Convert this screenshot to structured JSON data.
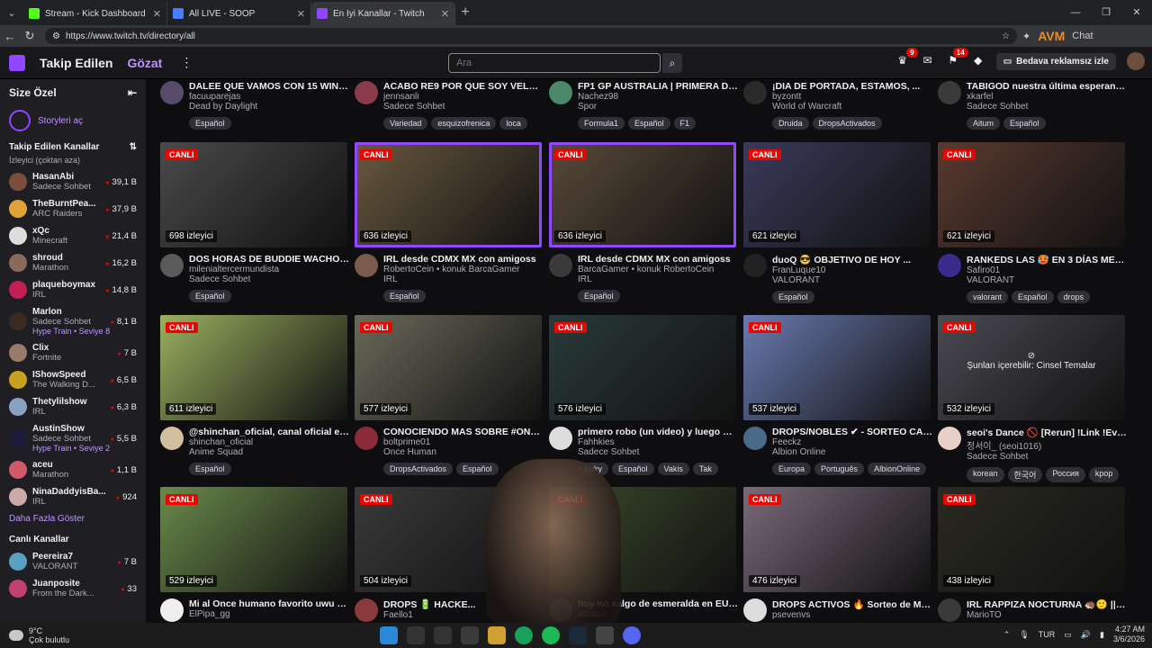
{
  "browser": {
    "tabs": [
      {
        "label": "Stream - Kick Dashboard",
        "color": "#53fc18"
      },
      {
        "label": "All LIVE - SOOP",
        "color": "#4a7cff"
      },
      {
        "label": "En İyi Kanallar - Twitch",
        "color": "#9146ff"
      }
    ],
    "url": "https://www.twitch.tv/directory/all",
    "ext_brand": "AVM",
    "ext_chat": "Chat"
  },
  "header": {
    "nav_following": "Takip Edilen",
    "nav_browse": "Gözat",
    "search_placeholder": "Ara",
    "badge_inbox": "9",
    "badge_notif": "14",
    "ad_free": "Bedava reklamsız izle"
  },
  "sidebar": {
    "title": "Size Özel",
    "stories": "Storyleri aç",
    "followed_title": "Takip Edilen Kanallar",
    "followed_sub": "İzleyici (çoktan aza)",
    "channels": [
      {
        "name": "HasanAbi",
        "game": "Sadece Sohbet",
        "viewers": "39,1 B",
        "color": "#7a4e3a"
      },
      {
        "name": "TheBurntPea...",
        "game": "ARC Raiders",
        "viewers": "37,9 B",
        "color": "#e2a23a"
      },
      {
        "name": "xQc",
        "game": "Minecraft",
        "viewers": "21,4 B",
        "color": "#ddd"
      },
      {
        "name": "shroud",
        "game": "Marathon",
        "viewers": "16,2 B",
        "color": "#8a6a5a"
      },
      {
        "name": "plaqueboymax",
        "game": "IRL",
        "viewers": "14,8 B",
        "color": "#c21f55"
      },
      {
        "name": "Marlon",
        "game": "Sadece Sohbet",
        "viewers": "8,1 B",
        "color": "#3a2a22",
        "hype": "Hype Train • Seviye 8"
      },
      {
        "name": "Clix",
        "game": "Fortnite",
        "viewers": "7 B",
        "color": "#9a7a6a"
      },
      {
        "name": "IShowSpeed",
        "game": "The Walking D...",
        "viewers": "6,5 B",
        "color": "#c9a020"
      },
      {
        "name": "Thetylilshow",
        "game": "IRL",
        "viewers": "6,3 B",
        "color": "#8aa0c0"
      },
      {
        "name": "AustinShow",
        "game": "Sadece Sohbet",
        "viewers": "5,5 B",
        "color": "#1a1a3a",
        "hype": "Hype Train • Seviye 2"
      },
      {
        "name": "aceu",
        "game": "Marathon",
        "viewers": "1,1 B",
        "color": "#d05a6a"
      },
      {
        "name": "NinaDaddyisBa...",
        "game": "IRL",
        "viewers": "924",
        "color": "#caa"
      }
    ],
    "show_more": "Daha Fazla Göster",
    "live_title": "Canlı Kanallar",
    "live_channels": [
      {
        "name": "Peereira7",
        "game": "VALORANT",
        "viewers": "7 B",
        "color": "#5aa0c0"
      },
      {
        "name": "Juanposite",
        "game": "From the Dark...",
        "viewers": "33",
        "color": "#c04070"
      }
    ]
  },
  "top_row": [
    {
      "title": "DALEE QUE VAMOS CON 15 WINS ...",
      "channel": "facuuparejas",
      "game": "Dead by Daylight",
      "tags": [
        "Español"
      ],
      "color": "#5a4a6a"
    },
    {
      "title": "ACABO RE9 POR QUE SOY VELOZZZ...",
      "channel": "jennsanli",
      "game": "Sadece Sohbet",
      "tags": [
        "Variedad",
        "esquizofrenica",
        "loca"
      ],
      "color": "#8a3a4a"
    },
    {
      "title": "FP1 GP AUSTRALIA | PRIMERA DEL A...",
      "channel": "Nachez98",
      "game": "Spor",
      "tags": [
        "Formula1",
        "Español",
        "F1"
      ],
      "color": "#4a8a6a"
    },
    {
      "title": "¡DIA DE PORTADA, ESTAMOS, ...",
      "channel": "byzontt",
      "game": "World of Warcraft",
      "tags": [
        "Druida",
        "DropsActivados"
      ],
      "color": "#2a2a2a"
    },
    {
      "title": "TABIGOD nuestra última esperanza e...",
      "channel": "xkarfel",
      "game": "Sadece Sohbet",
      "tags": [
        "Aitum",
        "Español"
      ],
      "color": "#3a3a3a"
    }
  ],
  "rows": [
    [
      {
        "title": "DOS HORAS DE BUDDIE WACHO BAS...",
        "channel": "milenialtercermundista",
        "game": "Sadece Sohbet",
        "tags": [
          "Español"
        ],
        "viewers": "698 izleyici",
        "thumb": "#4a4a4a",
        "avatar": "#5a5a5a"
      },
      {
        "title": "IRL desde CDMX MX con amigoss",
        "channel": "RobertoCein • konuk BarcaGamer",
        "game": "IRL",
        "tags": [
          "Español"
        ],
        "viewers": "636 izleyici",
        "thumb": "#6a5a40",
        "avatar": "#7a5a4a",
        "sel": true
      },
      {
        "title": "IRL desde CDMX MX con amigoss",
        "channel": "BarcaGamer • konuk RobertoCein",
        "game": "IRL",
        "tags": [
          "Español"
        ],
        "viewers": "636 izleyici",
        "thumb": "#5a4a3a",
        "avatar": "#3a3a3a",
        "sel": true
      },
      {
        "title": "duoQ 😎 OBJETIVO DE HOY ...",
        "channel": "FranLuque10",
        "game": "VALORANT",
        "tags": [
          "Español"
        ],
        "viewers": "621 izleyici",
        "thumb": "#3a3a5a",
        "avatar": "#222"
      },
      {
        "title": "RANKEDS LAS 🥵 EN 3 DÍAS ME V...",
        "channel": "Safiro01",
        "game": "VALORANT",
        "tags": [
          "valorant",
          "Español",
          "drops"
        ],
        "viewers": "621 izleyici",
        "thumb": "#5a3a30",
        "avatar": "#3a2a8a"
      }
    ],
    [
      {
        "title": "@shinchan_oficial, canal oficial en es...",
        "channel": "shinchan_oficial",
        "game": "Anime Squad",
        "tags": [
          "Español"
        ],
        "viewers": "611 izleyici",
        "thumb": "#9ab060",
        "avatar": "#d0c0a0"
      },
      {
        "title": "CONOCIENDO MAS SOBRE #ONCEH...",
        "channel": "boltprime01",
        "game": "Once Human",
        "tags": [
          "DropsActivados",
          "Español"
        ],
        "viewers": "577 izleyici",
        "thumb": "#6a6a5a",
        "avatar": "#8a2a3a"
      },
      {
        "title": "primero robo (un video) y luego me ro...",
        "channel": "Fahhkies",
        "game": "Sadece Sohbet",
        "tags": [
          "Keky",
          "Español",
          "Vakis",
          "Tak"
        ],
        "viewers": "576 izleyici",
        "thumb": "#2a3a3a",
        "avatar": "#ddd"
      },
      {
        "title": "DROPS/NOBLES ✔ - SORTEO CAD...",
        "channel": "Feeckz",
        "game": "Albion Online",
        "tags": [
          "Europa",
          "Português",
          "AlbionOnline"
        ],
        "viewers": "537 izleyici",
        "thumb": "#6a7ab0",
        "avatar": "#4a6a8a"
      },
      {
        "title": "seoi's Dance 🚫 [Rerun] !Link !Evt !IG",
        "channel": "정서이_ (seoi1016)",
        "game": "Sadece Sohbet",
        "tags": [
          "korean",
          "한국어",
          "Россия",
          "kpop"
        ],
        "viewers": "532 izleyici",
        "thumb": "#4a4a52",
        "avatar": "#e8d0c8",
        "warning": "Şunları içerebilir: Cinsel Temalar"
      }
    ],
    [
      {
        "title": "Mi al Once humano favorito uwu sliuu...",
        "channel": "ElPipa_gg",
        "game": "",
        "tags": [],
        "viewers": "529 izleyici",
        "thumb": "#6a8a4a",
        "avatar": "#eee"
      },
      {
        "title": "DROPS 🔋 HACKE...",
        "channel": "Faello1",
        "game": "",
        "tags": [],
        "viewers": "504 izleyici",
        "thumb": "#3a3a3a",
        "avatar": "#8a3a3a"
      },
      {
        "title": "hoy no salgo de esmeralda en EUW...",
        "channel": "sssaco",
        "game": "",
        "tags": [],
        "viewers": "",
        "thumb": "#3a4a2a",
        "avatar": "#5a5a5a"
      },
      {
        "title": "DROPS ACTIVOS 🔥 Sorteo de MAM...",
        "channel": "psevenvs",
        "game": "",
        "tags": [],
        "viewers": "476 izleyici",
        "thumb": "#7a6a7a",
        "avatar": "#ddd"
      },
      {
        "title": "IRL RAPPIZA NOCTURNA 🦔🙂 || !pri...",
        "channel": "MarioTO",
        "game": "",
        "tags": [],
        "viewers": "438 izleyici",
        "thumb": "#2a2a20",
        "avatar": "#3a3a3a"
      }
    ]
  ],
  "live_label": "CANLI",
  "taskbar": {
    "temp": "9°C",
    "weather": "Çok bulutlu",
    "lang": "TUR",
    "time": "4:27 AM",
    "date": "3/6/2026"
  }
}
